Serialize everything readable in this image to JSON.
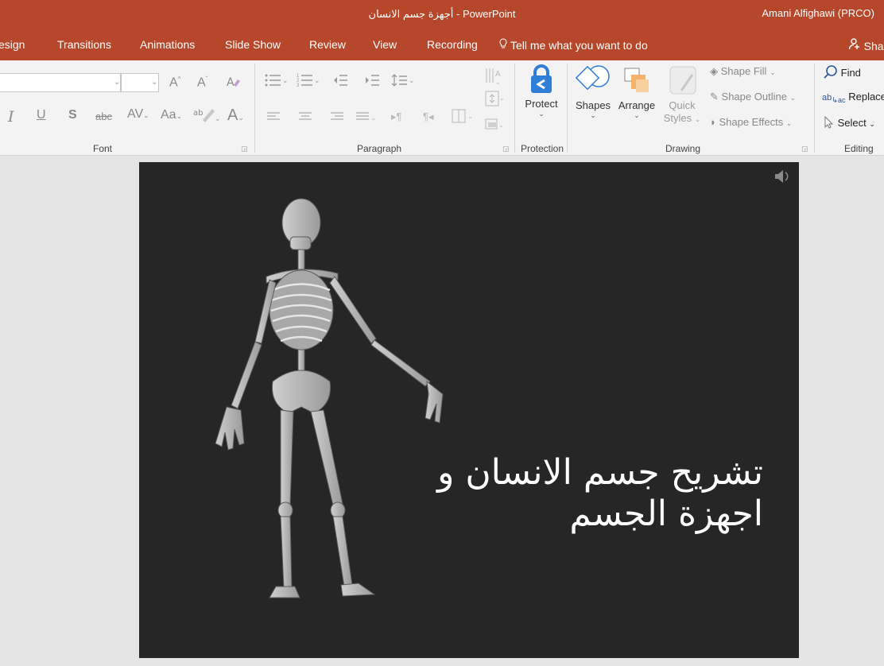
{
  "titlebar": {
    "doc_title": "أجهزة جسم الانسان  -  PowerPoint",
    "user": "Amani Alfighawi (PRCO)"
  },
  "tabs": [
    "esign",
    "Transitions",
    "Animations",
    "Slide Show",
    "Review",
    "View",
    "Recording"
  ],
  "tell_me": "Tell me what you want to do",
  "share": "Share",
  "ribbon": {
    "font_group": "Font",
    "paragraph_group": "Paragraph",
    "protection_group": "Protection",
    "drawing_group": "Drawing",
    "editing_group": "Editing",
    "protect_label": "Protect",
    "shapes_label": "Shapes",
    "arrange_label": "Arrange",
    "quick_styles_1": "Quick",
    "quick_styles_2": "Styles",
    "shape_fill": "Shape Fill",
    "shape_outline": "Shape Outline",
    "shape_effects": "Shape Effects",
    "find": "Find",
    "replace": "Replace",
    "select": "Select"
  },
  "slide": {
    "title_line1": "تشريح جسم الانسان و",
    "title_line2": "اجهزة الجسم"
  },
  "colors": {
    "accent": "#b7472a",
    "ribbon_bg": "#f3f3f3",
    "slide_bg": "#262626",
    "protect_blue": "#2f7ed8",
    "arrange_orange": "#f4b26a"
  }
}
